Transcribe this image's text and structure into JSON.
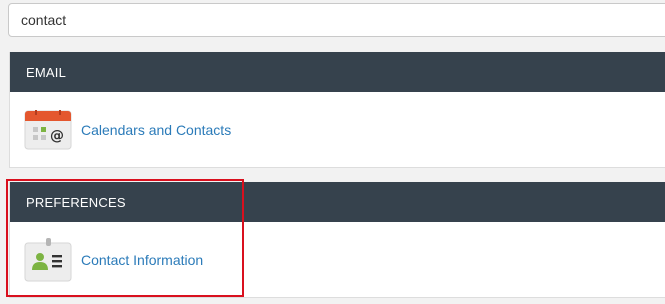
{
  "search": {
    "value": "contact",
    "placeholder": ""
  },
  "groups": [
    {
      "title": "EMAIL",
      "items": [
        {
          "label": "Calendars and Contacts",
          "icon": "calendar-contacts-icon"
        }
      ]
    },
    {
      "title": "PREFERENCES",
      "items": [
        {
          "label": "Contact Information",
          "icon": "contact-card-icon"
        }
      ]
    }
  ],
  "colors": {
    "header_bg": "#36424d",
    "link": "#2b7bb9",
    "highlight": "#d9101e",
    "calendar_accent": "#e4572e",
    "contact_green": "#7cb342"
  }
}
